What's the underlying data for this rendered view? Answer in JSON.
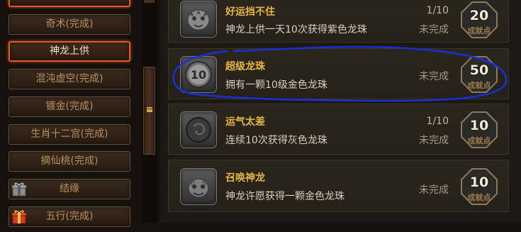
{
  "sidebar": {
    "items": [
      {
        "label": "奇术(完成)"
      },
      {
        "label": "神龙上供",
        "active": true
      },
      {
        "label": "混沌虚空(完成)"
      },
      {
        "label": "镀金(完成)"
      },
      {
        "label": "生肖十二宫(完成)"
      },
      {
        "label": "摘仙桃(完成)"
      },
      {
        "label": "结缘",
        "icon": "gift-box-gray-icon"
      },
      {
        "label": "五行(完成)",
        "icon": "gift-box-red-icon"
      }
    ]
  },
  "achievements": [
    {
      "title": "好运挡不住",
      "desc": "神龙上供一天10次获得紫色龙珠",
      "progress": "1/10",
      "status": "未完成",
      "points": "20",
      "points_label": "成就点",
      "icon": "tiger-head-icon"
    },
    {
      "title": "超级龙珠",
      "desc": "拥有一颗10级金色龙珠",
      "progress": "",
      "status": "未完成",
      "points": "50",
      "points_label": "成就点",
      "icon": "level-10-orb-icon",
      "icon_text": "10"
    },
    {
      "title": "运气太差",
      "desc": "连续10次获得灰色龙珠",
      "progress": "1/10",
      "status": "未完成",
      "points": "10",
      "points_label": "成就点",
      "icon": "gray-orb-icon"
    },
    {
      "title": "召唤神龙",
      "desc": "神龙许愿获得一颗金色龙珠",
      "progress": "",
      "status": "未完成",
      "points": "10",
      "points_label": "成就点",
      "icon": "dragon-head-icon"
    }
  ],
  "colors": {
    "title_gold": "#e4b548",
    "active_border": "#e3582a",
    "annotation_blue": "#1a2fd6"
  }
}
